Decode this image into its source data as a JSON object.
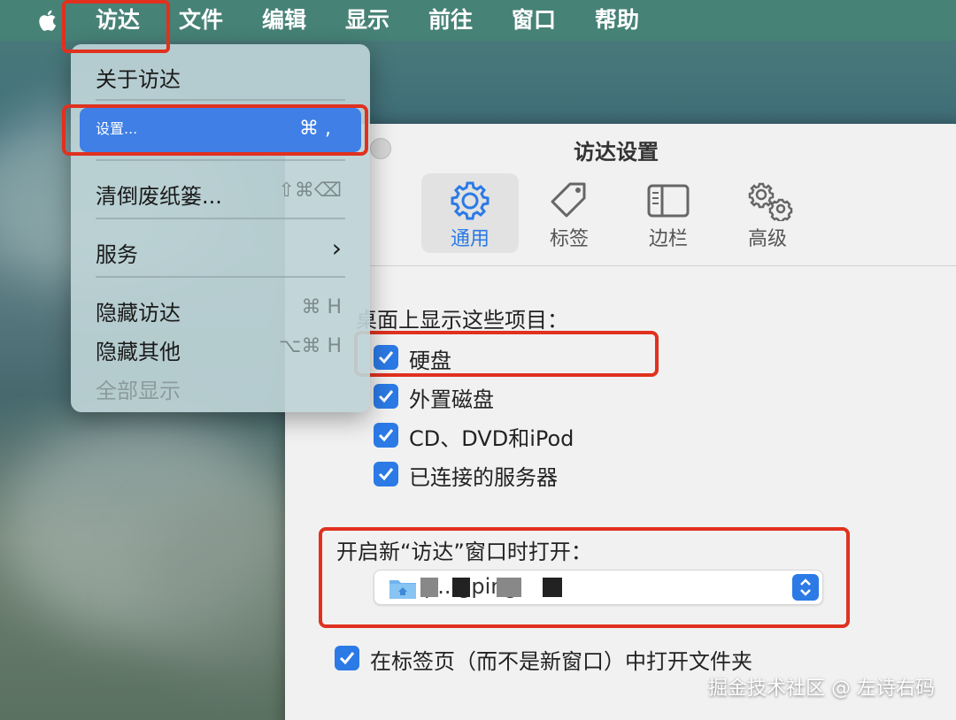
{
  "menubar": {
    "items": [
      "访达",
      "文件",
      "编辑",
      "显示",
      "前往",
      "窗口",
      "帮助"
    ]
  },
  "dropdown": {
    "about": "关于访达",
    "settings": {
      "label": "设置...",
      "shortcut": "⌘ ,"
    },
    "empty_trash": {
      "label": "清倒废纸篓...",
      "shortcut": "⇧⌘⌫"
    },
    "services": {
      "label": "服务",
      "shortcut": "›"
    },
    "hide": {
      "label": "隐藏访达",
      "shortcut": "⌘ H"
    },
    "hide_others": {
      "label": "隐藏其他",
      "shortcut": "⌥⌘ H"
    },
    "show_all": "全部显示"
  },
  "settings": {
    "title": "访达设置",
    "tabs": [
      "通用",
      "标签",
      "边栏",
      "高级"
    ],
    "desktop_section": "桌面上显示这些项目：",
    "desktop_items": [
      "硬盘",
      "外置磁盘",
      "CD、DVD和iPod",
      "已连接的服务器"
    ],
    "new_window_label": "开启新“访达”窗口时打开：",
    "new_window_value": "p...gping",
    "open_in_tabs": "在标签页（而不是新窗口）中打开文件夹"
  },
  "watermark": "掘金技术社区 @ 左诗右码",
  "colors": {
    "accent": "#2b7ae6",
    "annotation": "#e0311f"
  }
}
